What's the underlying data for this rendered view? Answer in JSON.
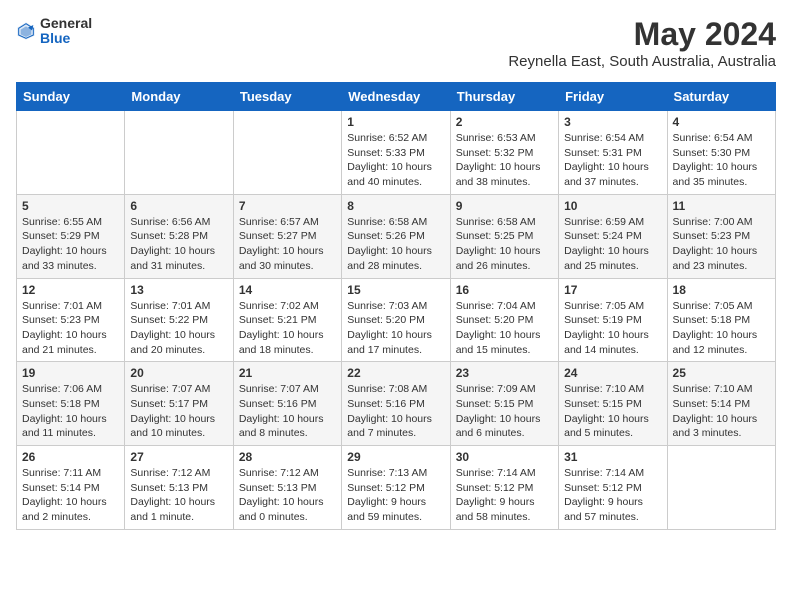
{
  "logo": {
    "general": "General",
    "blue": "Blue"
  },
  "title": "May 2024",
  "subtitle": "Reynella East, South Australia, Australia",
  "days_of_week": [
    "Sunday",
    "Monday",
    "Tuesday",
    "Wednesday",
    "Thursday",
    "Friday",
    "Saturday"
  ],
  "weeks": [
    [
      {
        "day": "",
        "info": ""
      },
      {
        "day": "",
        "info": ""
      },
      {
        "day": "",
        "info": ""
      },
      {
        "day": "1",
        "info": "Sunrise: 6:52 AM\nSunset: 5:33 PM\nDaylight: 10 hours\nand 40 minutes."
      },
      {
        "day": "2",
        "info": "Sunrise: 6:53 AM\nSunset: 5:32 PM\nDaylight: 10 hours\nand 38 minutes."
      },
      {
        "day": "3",
        "info": "Sunrise: 6:54 AM\nSunset: 5:31 PM\nDaylight: 10 hours\nand 37 minutes."
      },
      {
        "day": "4",
        "info": "Sunrise: 6:54 AM\nSunset: 5:30 PM\nDaylight: 10 hours\nand 35 minutes."
      }
    ],
    [
      {
        "day": "5",
        "info": "Sunrise: 6:55 AM\nSunset: 5:29 PM\nDaylight: 10 hours\nand 33 minutes."
      },
      {
        "day": "6",
        "info": "Sunrise: 6:56 AM\nSunset: 5:28 PM\nDaylight: 10 hours\nand 31 minutes."
      },
      {
        "day": "7",
        "info": "Sunrise: 6:57 AM\nSunset: 5:27 PM\nDaylight: 10 hours\nand 30 minutes."
      },
      {
        "day": "8",
        "info": "Sunrise: 6:58 AM\nSunset: 5:26 PM\nDaylight: 10 hours\nand 28 minutes."
      },
      {
        "day": "9",
        "info": "Sunrise: 6:58 AM\nSunset: 5:25 PM\nDaylight: 10 hours\nand 26 minutes."
      },
      {
        "day": "10",
        "info": "Sunrise: 6:59 AM\nSunset: 5:24 PM\nDaylight: 10 hours\nand 25 minutes."
      },
      {
        "day": "11",
        "info": "Sunrise: 7:00 AM\nSunset: 5:23 PM\nDaylight: 10 hours\nand 23 minutes."
      }
    ],
    [
      {
        "day": "12",
        "info": "Sunrise: 7:01 AM\nSunset: 5:23 PM\nDaylight: 10 hours\nand 21 minutes."
      },
      {
        "day": "13",
        "info": "Sunrise: 7:01 AM\nSunset: 5:22 PM\nDaylight: 10 hours\nand 20 minutes."
      },
      {
        "day": "14",
        "info": "Sunrise: 7:02 AM\nSunset: 5:21 PM\nDaylight: 10 hours\nand 18 minutes."
      },
      {
        "day": "15",
        "info": "Sunrise: 7:03 AM\nSunset: 5:20 PM\nDaylight: 10 hours\nand 17 minutes."
      },
      {
        "day": "16",
        "info": "Sunrise: 7:04 AM\nSunset: 5:20 PM\nDaylight: 10 hours\nand 15 minutes."
      },
      {
        "day": "17",
        "info": "Sunrise: 7:05 AM\nSunset: 5:19 PM\nDaylight: 10 hours\nand 14 minutes."
      },
      {
        "day": "18",
        "info": "Sunrise: 7:05 AM\nSunset: 5:18 PM\nDaylight: 10 hours\nand 12 minutes."
      }
    ],
    [
      {
        "day": "19",
        "info": "Sunrise: 7:06 AM\nSunset: 5:18 PM\nDaylight: 10 hours\nand 11 minutes."
      },
      {
        "day": "20",
        "info": "Sunrise: 7:07 AM\nSunset: 5:17 PM\nDaylight: 10 hours\nand 10 minutes."
      },
      {
        "day": "21",
        "info": "Sunrise: 7:07 AM\nSunset: 5:16 PM\nDaylight: 10 hours\nand 8 minutes."
      },
      {
        "day": "22",
        "info": "Sunrise: 7:08 AM\nSunset: 5:16 PM\nDaylight: 10 hours\nand 7 minutes."
      },
      {
        "day": "23",
        "info": "Sunrise: 7:09 AM\nSunset: 5:15 PM\nDaylight: 10 hours\nand 6 minutes."
      },
      {
        "day": "24",
        "info": "Sunrise: 7:10 AM\nSunset: 5:15 PM\nDaylight: 10 hours\nand 5 minutes."
      },
      {
        "day": "25",
        "info": "Sunrise: 7:10 AM\nSunset: 5:14 PM\nDaylight: 10 hours\nand 3 minutes."
      }
    ],
    [
      {
        "day": "26",
        "info": "Sunrise: 7:11 AM\nSunset: 5:14 PM\nDaylight: 10 hours\nand 2 minutes."
      },
      {
        "day": "27",
        "info": "Sunrise: 7:12 AM\nSunset: 5:13 PM\nDaylight: 10 hours\nand 1 minute."
      },
      {
        "day": "28",
        "info": "Sunrise: 7:12 AM\nSunset: 5:13 PM\nDaylight: 10 hours\nand 0 minutes."
      },
      {
        "day": "29",
        "info": "Sunrise: 7:13 AM\nSunset: 5:12 PM\nDaylight: 9 hours\nand 59 minutes."
      },
      {
        "day": "30",
        "info": "Sunrise: 7:14 AM\nSunset: 5:12 PM\nDaylight: 9 hours\nand 58 minutes."
      },
      {
        "day": "31",
        "info": "Sunrise: 7:14 AM\nSunset: 5:12 PM\nDaylight: 9 hours\nand 57 minutes."
      },
      {
        "day": "",
        "info": ""
      }
    ]
  ]
}
